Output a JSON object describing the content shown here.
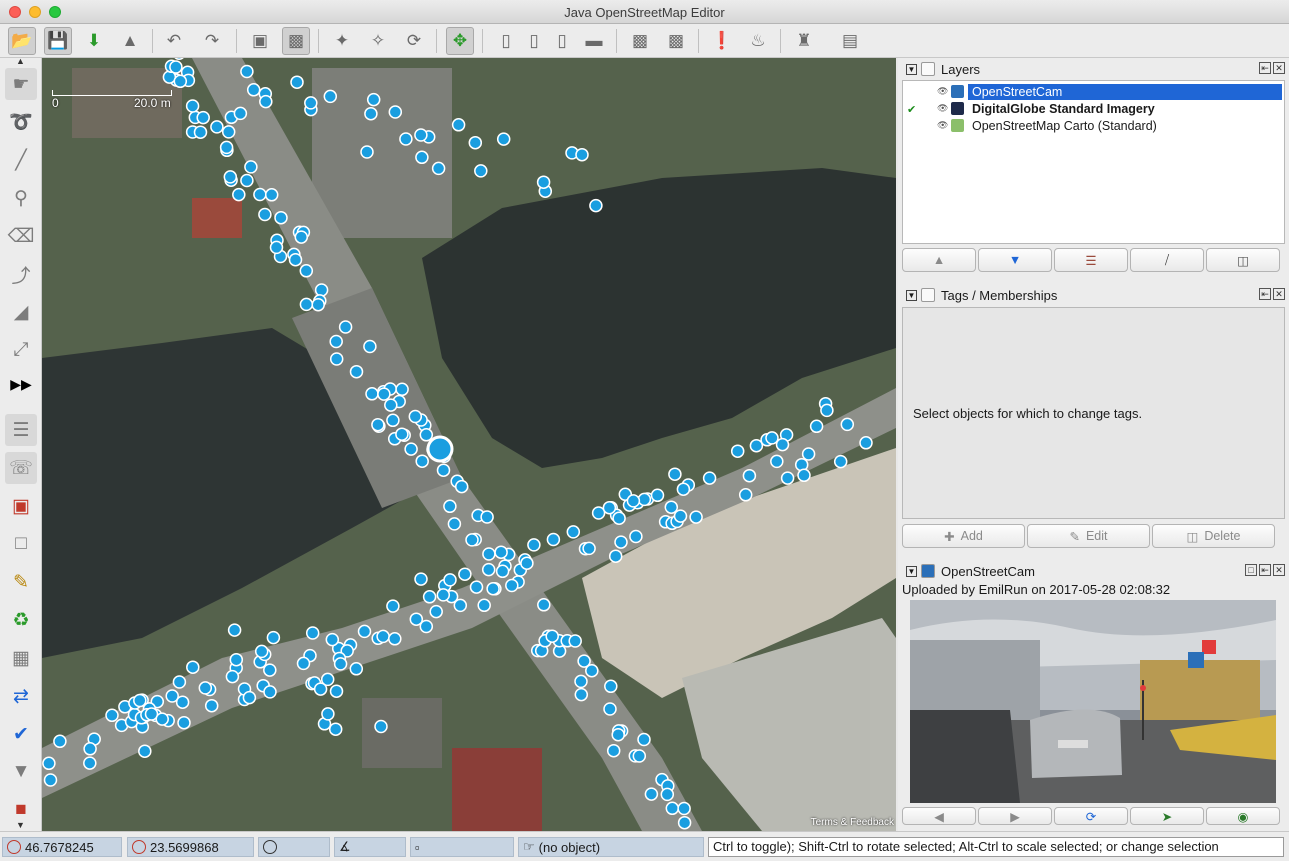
{
  "window": {
    "title": "Java OpenStreetMap Editor"
  },
  "map": {
    "scale_zero": "0",
    "scale_label": "20.0 m",
    "attribution": "Terms & Feedback"
  },
  "layers_panel": {
    "title": "Layers",
    "layers": [
      {
        "name": "OpenStreetCam",
        "selected": true,
        "bold": false,
        "active": false,
        "icon": "globe-icon"
      },
      {
        "name": "DigitalGlobe Standard Imagery",
        "selected": false,
        "bold": true,
        "active": true,
        "icon": "imagery-icon"
      },
      {
        "name": "OpenStreetMap Carto (Standard)",
        "selected": false,
        "bold": false,
        "active": false,
        "icon": "map-icon"
      }
    ],
    "buttons": [
      "move-up",
      "move-down",
      "merge",
      "toggle-visibility",
      "delete"
    ]
  },
  "tags_panel": {
    "title": "Tags / Memberships",
    "message": "Select objects for which to change tags.",
    "add_label": "Add",
    "edit_label": "Edit",
    "delete_label": "Delete"
  },
  "osc_panel": {
    "title": "OpenStreetCam",
    "upload_info": "Uploaded by EmilRun  on 2017-05-28 02:08:32"
  },
  "status": {
    "lat": "46.7678245",
    "lon": "23.5699868",
    "heading": "",
    "angle": "",
    "distance": "",
    "object": "(no object)",
    "help": "Ctrl to toggle); Shift-Ctrl to rotate selected; Alt-Ctrl to scale selected; or change selection"
  },
  "colors": {
    "photo_marker": "#1a9ee0",
    "selection_blue": "#1f66d6",
    "status_field": "#c7d4e2"
  }
}
